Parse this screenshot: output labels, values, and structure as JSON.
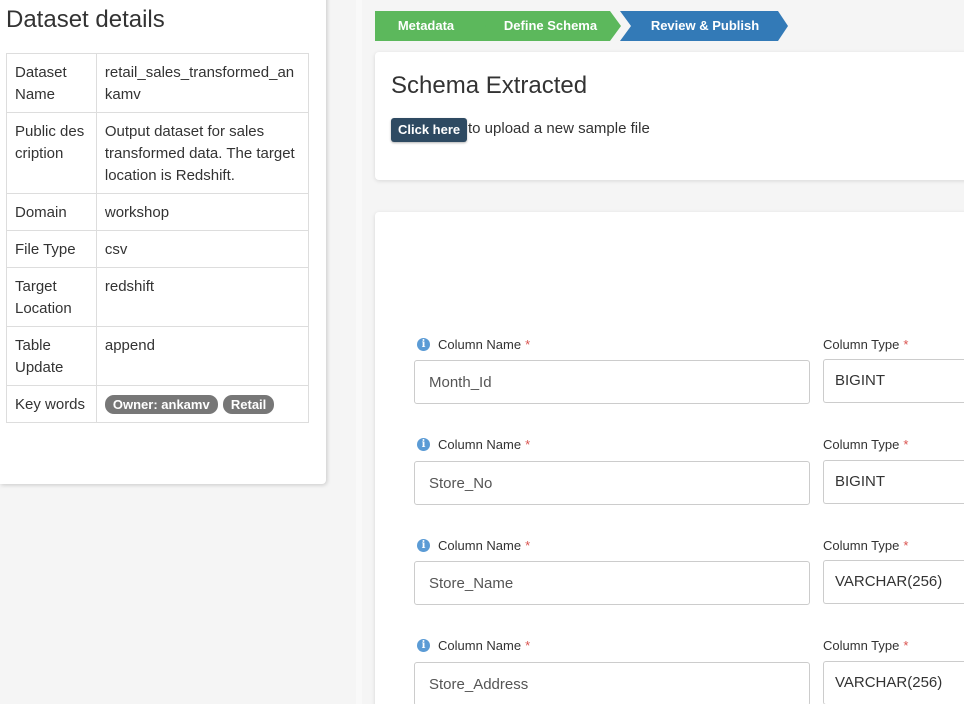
{
  "dataset_details": {
    "title": "Dataset details",
    "rows": [
      {
        "key": "Dataset Name",
        "value": "retail_sales_transformed_ankamv"
      },
      {
        "key": "Public description",
        "value": "Output dataset for sales transformed data. The target location is Redshift."
      },
      {
        "key": "Domain",
        "value": "workshop"
      },
      {
        "key": "File Type",
        "value": "csv"
      },
      {
        "key": "Target Location",
        "value": "redshift"
      },
      {
        "key": "Table Update",
        "value": "append"
      },
      {
        "key": "Key words",
        "value": ""
      }
    ],
    "keywords": [
      "Owner: ankamv",
      "Retail"
    ]
  },
  "wizard": {
    "steps": [
      {
        "label": "Metadata",
        "state": "done"
      },
      {
        "label": "Define Schema",
        "state": "done"
      },
      {
        "label": "Review & Publish",
        "state": "active"
      }
    ],
    "colors": {
      "done": "#5cb85c",
      "active": "#337ab7"
    }
  },
  "schema": {
    "title": "Schema Extracted",
    "upload_button": "Click here",
    "upload_text": "to upload a new sample file",
    "column_name_label": "Column Name",
    "column_type_label": "Column Type",
    "required_mark": "*",
    "info_icon": "i",
    "columns": [
      {
        "name": "Month_Id",
        "type": "BIGINT"
      },
      {
        "name": "Store_No",
        "type": "BIGINT"
      },
      {
        "name": "Store_Name",
        "type": "VARCHAR(256)"
      },
      {
        "name": "Store_Address",
        "type": "VARCHAR(256)"
      }
    ]
  }
}
